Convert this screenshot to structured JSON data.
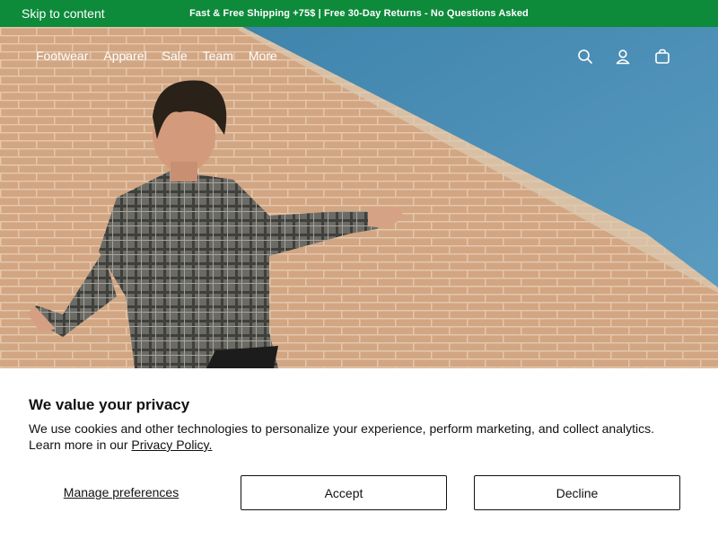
{
  "topbar": {
    "skip_link": "Skip to content",
    "announcement": "Fast & Free Shipping +75$ | Free 30-Day Returns - No Questions Asked",
    "background_color": "#0d8a3a"
  },
  "nav": {
    "items": [
      {
        "label": "Footwear"
      },
      {
        "label": "Apparel"
      },
      {
        "label": "Sale"
      },
      {
        "label": "Team"
      },
      {
        "label": "More"
      }
    ]
  },
  "header_icons": [
    "search-icon",
    "account-icon",
    "cart-icon"
  ],
  "hero": {
    "image": "skateboarder in plaid shirt in front of brick wall with blue ramp"
  },
  "consent": {
    "title": "We value your privacy",
    "text": "We use cookies and other technologies to personalize your experience, perform marketing, and collect analytics. Learn more in our ",
    "policy_link": "Privacy Policy.",
    "manage_label": "Manage preferences",
    "accept_label": "Accept",
    "decline_label": "Decline"
  }
}
